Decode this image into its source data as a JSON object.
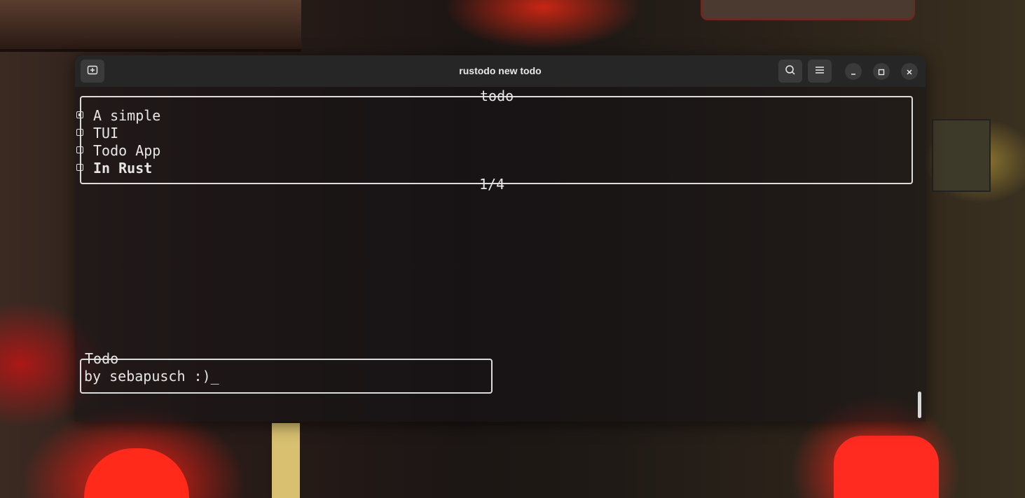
{
  "window": {
    "title": "rustodo new todo",
    "icons": {
      "new_tab": "new-tab-icon",
      "search": "search-icon",
      "menu": "hamburger-menu-icon",
      "minimize": "minimize-icon",
      "maximize": "maximize-icon",
      "close": "close-icon"
    }
  },
  "todo_panel": {
    "title": "todo",
    "page_indicator": "1/4",
    "items": [
      {
        "label": "A simple",
        "checked": true,
        "bold": false
      },
      {
        "label": "TUI",
        "checked": false,
        "bold": false
      },
      {
        "label": "Todo App",
        "checked": false,
        "bold": false
      },
      {
        "label": "In Rust",
        "checked": false,
        "bold": true
      }
    ]
  },
  "input_panel": {
    "title": "Todo",
    "value": "by sebapusch :)_"
  },
  "colors": {
    "titlebar": "#262626",
    "terminal_fg": "#e6e6e6",
    "border": "#dcdcdc"
  }
}
